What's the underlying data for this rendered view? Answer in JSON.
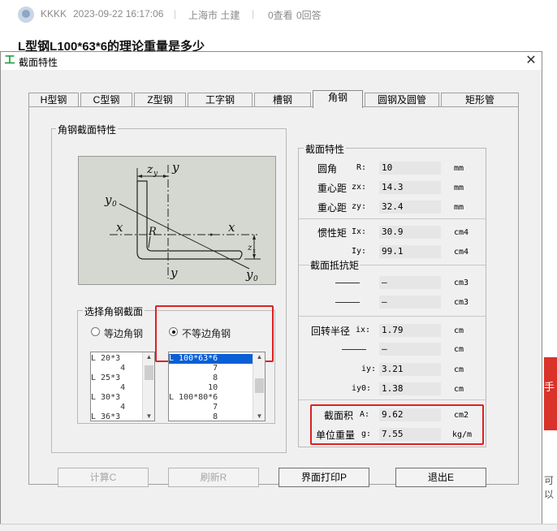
{
  "forum": {
    "user": "KKKK",
    "datetime": "2023-09-22 16:17:06",
    "sep": "|",
    "location": "上海市 土建",
    "views": "0查看",
    "answers": "0回答",
    "question_title": "L型钢L100*63*6的理论重量是多少",
    "side_snippet": "手",
    "side_snippet2": "可以"
  },
  "window": {
    "title": "截面特性",
    "icon_glyph": "工",
    "close_glyph": "✕"
  },
  "tabs": [
    "H型钢",
    "C型钢",
    "Z型钢",
    "工字钢",
    "槽钢",
    "角钢",
    "圆钢及圆管",
    "矩形管"
  ],
  "active_tab": "角钢",
  "left_group": {
    "title": "角钢截面特性",
    "diagram_labels": {
      "zy": "z",
      "zy_sub": "y",
      "y_top": "y",
      "y0": "y",
      "y0_sub": "0",
      "x_left": "x",
      "x_right": "x",
      "R": "R",
      "zx": "z",
      "zx_sub": "x",
      "y_bottom": "y",
      "y0b": "y",
      "y0b_sub": "0"
    }
  },
  "select_group": {
    "title": "选择角钢截面",
    "radio_equal": "等边角钢",
    "radio_unequal": "不等边角钢",
    "selected": "不等边角钢",
    "equal_list": [
      "L 20*3",
      "      4",
      "L 25*3",
      "      4",
      "L 30*3",
      "      4",
      "L 36*3"
    ],
    "unequal_list": [
      "L 100*63*6",
      "         7",
      "         8",
      "        10",
      "L 100*80*6",
      "         7",
      "         8"
    ],
    "unequal_selected": "L 100*63*6"
  },
  "props": {
    "title": "截面特性",
    "radius_label": "圆角",
    "radius_sym": "R:",
    "radius_val": "10",
    "radius_unit": "mm",
    "zx_label": "重心距",
    "zx_sym": "zx:",
    "zx_val": "14.3",
    "zx_unit": "mm",
    "zy_label": "重心距",
    "zy_sym": "zy:",
    "zy_val": "32.4",
    "zy_unit": "mm",
    "ix_label": "惯性矩",
    "ix_sym": "Ix:",
    "ix_val": "30.9",
    "ix_unit": "cm4",
    "iy_sym": "Iy:",
    "iy_val": "99.1",
    "iy_unit": "cm4",
    "w_title": "截面抵抗矩",
    "w1_val": "—",
    "w1_unit": "cm3",
    "w2_val": "—",
    "w2_unit": "cm3",
    "gx_label": "回转半径",
    "gx_sym": "ix:",
    "gx_val": "1.79",
    "gx_unit": "cm",
    "g2_val": "—",
    "g2_unit": "cm",
    "gy_sym": "iy:",
    "gy_val": "3.21",
    "gy_unit": "cm",
    "gy0_sym": "iy0:",
    "gy0_val": "1.38",
    "gy0_unit": "cm",
    "area_label": "截面积",
    "area_sym": "A:",
    "area_val": "9.62",
    "area_unit": "cm2",
    "weight_label": "单位重量",
    "weight_sym": "g:",
    "weight_val": "7.55",
    "weight_unit": "kg/m"
  },
  "buttons": {
    "calc": "计算C",
    "refresh": "刷新R",
    "print": "界面打印P",
    "exit": "退出E"
  }
}
